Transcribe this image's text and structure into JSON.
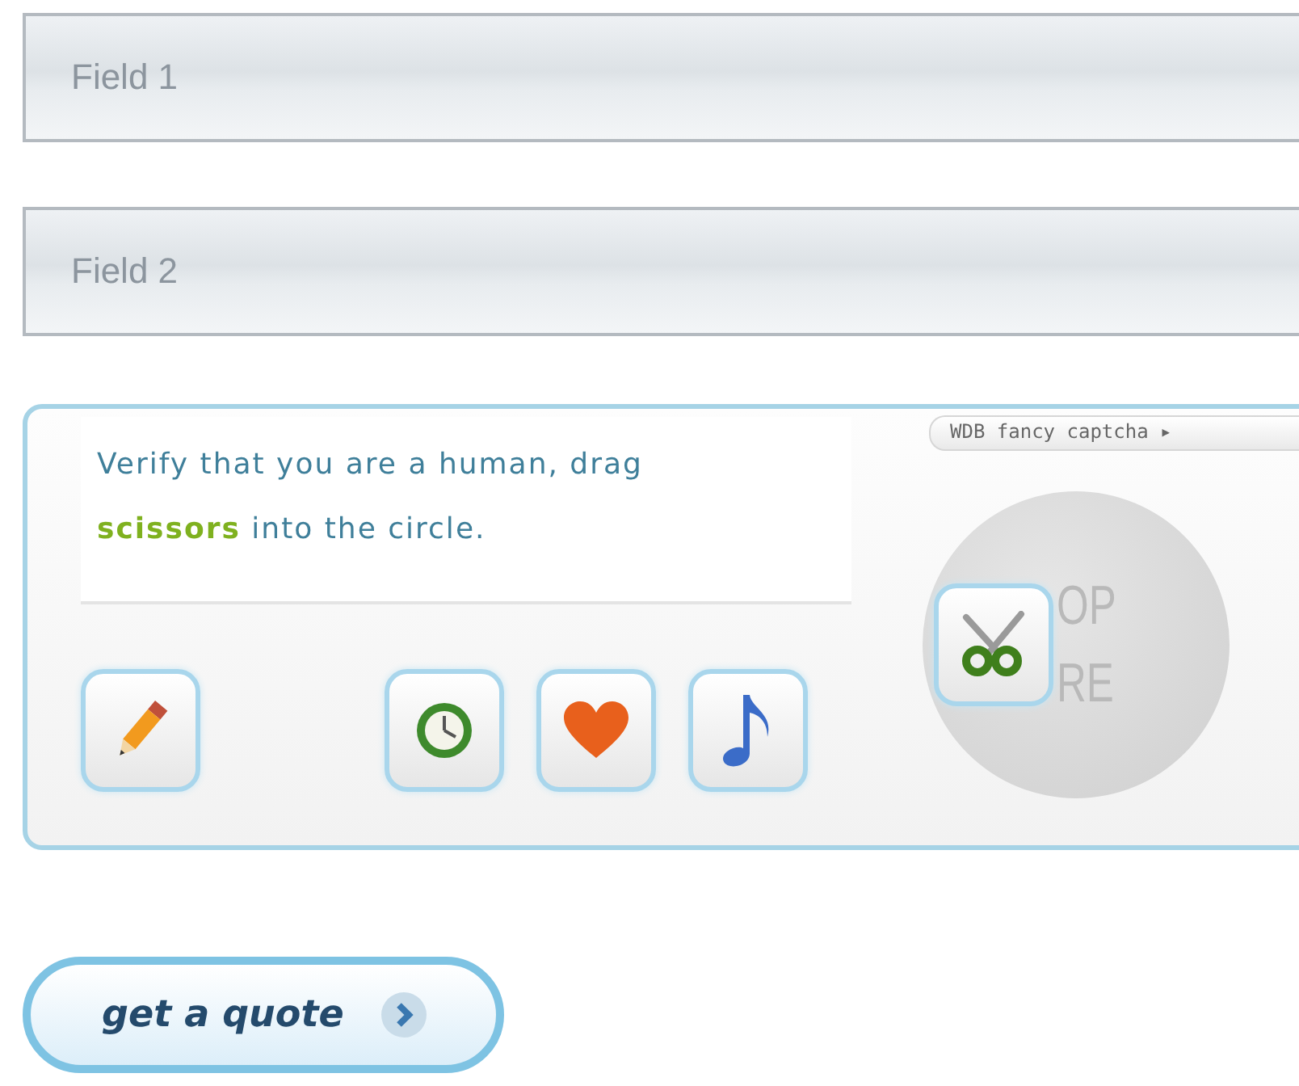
{
  "fields": [
    {
      "placeholder": "Field 1"
    },
    {
      "placeholder": "Field 2"
    }
  ],
  "captcha": {
    "tab": "WDB fancy captcha ▸",
    "instructions": "Verify that you are a human, drag **scissors** into the circle.",
    "icons": [
      {
        "kind": "pencil"
      },
      {
        "kind": "spacer"
      },
      {
        "kind": "clock"
      },
      {
        "kind": "heart"
      },
      {
        "kind": "note"
      }
    ],
    "drop_zone": {
      "lines": [
        "OP",
        "RE"
      ],
      "item": {
        "kind": "scissors"
      }
    }
  },
  "button": {
    "label": "get a quote"
  }
}
